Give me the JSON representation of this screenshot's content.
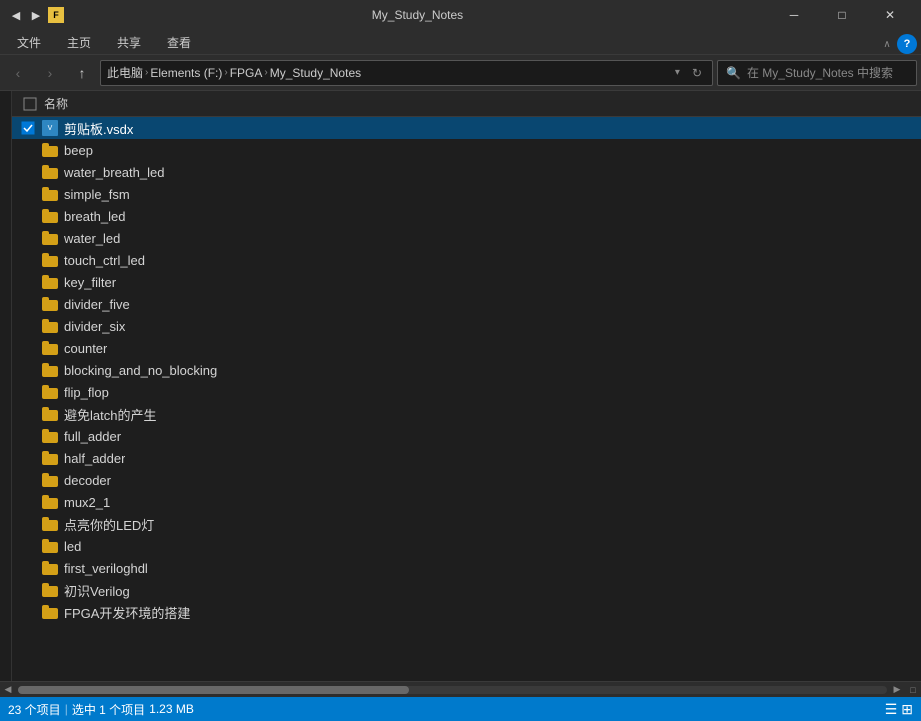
{
  "titlebar": {
    "title": "My_Study_Notes",
    "minimize": "─",
    "maximize": "□",
    "close": "✕"
  },
  "ribbon": {
    "tabs": [
      "文件",
      "主页",
      "共享",
      "查看"
    ]
  },
  "navbar": {
    "back": "‹",
    "forward": "›",
    "up": "↑",
    "breadcrumbs": [
      "此电脑",
      "Elements (F:)",
      "FPGA",
      "My_Study_Notes"
    ],
    "search_placeholder": "在 My_Study_Notes 中搜索"
  },
  "column_header": {
    "name_label": "名称"
  },
  "files": [
    {
      "name": "剪贴板.vsdx",
      "type": "vsdx",
      "selected": true,
      "checked": true
    },
    {
      "name": "beep",
      "type": "folder",
      "selected": false
    },
    {
      "name": "water_breath_led",
      "type": "folder",
      "selected": false
    },
    {
      "name": "simple_fsm",
      "type": "folder",
      "selected": false
    },
    {
      "name": "breath_led",
      "type": "folder",
      "selected": false
    },
    {
      "name": "water_led",
      "type": "folder",
      "selected": false
    },
    {
      "name": "touch_ctrl_led",
      "type": "folder",
      "selected": false
    },
    {
      "name": "key_filter",
      "type": "folder",
      "selected": false
    },
    {
      "name": "divider_five",
      "type": "folder",
      "selected": false
    },
    {
      "name": "divider_six",
      "type": "folder",
      "selected": false
    },
    {
      "name": "counter",
      "type": "folder",
      "selected": false
    },
    {
      "name": "blocking_and_no_blocking",
      "type": "folder",
      "selected": false
    },
    {
      "name": "flip_flop",
      "type": "folder",
      "selected": false
    },
    {
      "name": "避免latch的产生",
      "type": "folder",
      "selected": false
    },
    {
      "name": "full_adder",
      "type": "folder",
      "selected": false
    },
    {
      "name": "half_adder",
      "type": "folder",
      "selected": false
    },
    {
      "name": "decoder",
      "type": "folder",
      "selected": false
    },
    {
      "name": "mux2_1",
      "type": "folder",
      "selected": false
    },
    {
      "name": "点亮你的LED灯",
      "type": "folder",
      "selected": false
    },
    {
      "name": "led",
      "type": "folder",
      "selected": false
    },
    {
      "name": "first_veriloghdl",
      "type": "folder",
      "selected": false
    },
    {
      "name": "初识Verilog",
      "type": "folder",
      "selected": false
    },
    {
      "name": "FPGA开发环境的搭建",
      "type": "folder",
      "selected": false
    }
  ],
  "statusbar": {
    "count": "23 个项目",
    "selected": "选中 1 个项目",
    "size": "1.23 MB"
  }
}
